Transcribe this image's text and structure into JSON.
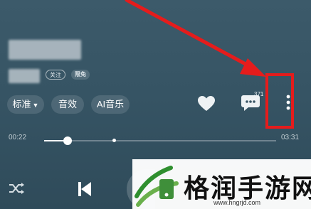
{
  "song": {
    "title_blurred": true,
    "artist_blurred": true
  },
  "tags": {
    "follow": "关注",
    "vip": "限免"
  },
  "options": {
    "quality": "标准",
    "effect": "音效",
    "ai_music": "AI音乐"
  },
  "actions": {
    "comment_count": "371",
    "like_icon": "heart-icon",
    "comment_icon": "comment-icon",
    "more_icon": "more-vertical-icon"
  },
  "progress": {
    "elapsed": "00:22",
    "total": "03:31",
    "fraction": 0.1
  },
  "controls": {
    "shuffle_icon": "shuffle-icon",
    "prev_icon": "previous-icon"
  },
  "annotation": {
    "color": "#e51c1c"
  },
  "watermark": {
    "text": "格润手游网",
    "url": "www.hngrjd.com"
  }
}
